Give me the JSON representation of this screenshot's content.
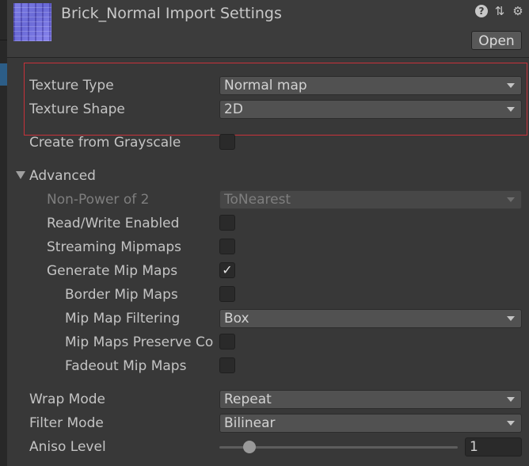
{
  "header": {
    "title": "Brick_Normal Import Settings",
    "open_label": "Open",
    "icons": [
      "help-icon",
      "preset-icon",
      "settings-gear-icon"
    ]
  },
  "main": {
    "texture_type": {
      "label": "Texture Type",
      "value": "Normal map"
    },
    "texture_shape": {
      "label": "Texture Shape",
      "value": "2D"
    },
    "create_from_grayscale": {
      "label": "Create from Grayscale",
      "checked": false
    },
    "advanced": {
      "label": "Advanced",
      "expanded": true,
      "non_power_of_2": {
        "label": "Non-Power of 2",
        "value": "ToNearest",
        "disabled": true
      },
      "read_write": {
        "label": "Read/Write Enabled",
        "checked": false
      },
      "streaming_mipmaps": {
        "label": "Streaming Mipmaps",
        "checked": false
      },
      "generate_mip_maps": {
        "label": "Generate Mip Maps",
        "checked": true,
        "check_glyph": "✓"
      },
      "border_mip_maps": {
        "label": "Border Mip Maps",
        "checked": false
      },
      "mip_map_filtering": {
        "label": "Mip Map Filtering",
        "value": "Box"
      },
      "mip_maps_preserve_coverage": {
        "label": "Mip Maps Preserve Co",
        "checked": false
      },
      "fadeout_mip_maps": {
        "label": "Fadeout Mip Maps",
        "checked": false
      }
    },
    "wrap_mode": {
      "label": "Wrap Mode",
      "value": "Repeat"
    },
    "filter_mode": {
      "label": "Filter Mode",
      "value": "Bilinear"
    },
    "aniso_level": {
      "label": "Aniso Level",
      "value": "1",
      "slider_fraction": 0.08
    }
  },
  "colors": {
    "highlight_outline": "#c8323a",
    "selection": "#2c5d87"
  }
}
